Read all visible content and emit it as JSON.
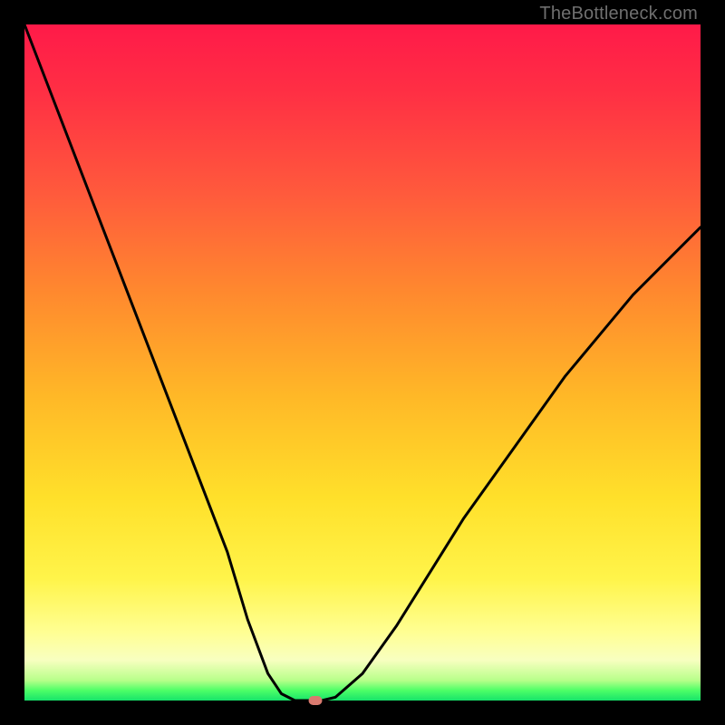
{
  "watermark": "TheBottleneck.com",
  "chart_data": {
    "type": "line",
    "title": "",
    "xlabel": "",
    "ylabel": "",
    "xlim": [
      0,
      100
    ],
    "ylim": [
      0,
      100
    ],
    "grid": false,
    "legend": false,
    "series": [
      {
        "name": "bottleneck-curve",
        "x": [
          0,
          5,
          10,
          15,
          20,
          25,
          30,
          33,
          36,
          38,
          40,
          42,
          44,
          46,
          50,
          55,
          60,
          65,
          70,
          75,
          80,
          85,
          90,
          95,
          100
        ],
        "values": [
          100,
          87,
          74,
          61,
          48,
          35,
          22,
          12,
          4,
          1,
          0,
          0,
          0,
          0.5,
          4,
          11,
          19,
          27,
          34,
          41,
          48,
          54,
          60,
          65,
          70
        ]
      }
    ],
    "marker": {
      "x": 43,
      "y": 0,
      "color": "#d97a6f"
    },
    "gradient_stops": [
      {
        "pct": 0,
        "color": "#ff1a49"
      },
      {
        "pct": 25,
        "color": "#ff5a3c"
      },
      {
        "pct": 55,
        "color": "#ffb827"
      },
      {
        "pct": 82,
        "color": "#fff44a"
      },
      {
        "pct": 94,
        "color": "#f8ffc0"
      },
      {
        "pct": 98.5,
        "color": "#4dff67"
      },
      {
        "pct": 100,
        "color": "#17e36a"
      }
    ]
  }
}
